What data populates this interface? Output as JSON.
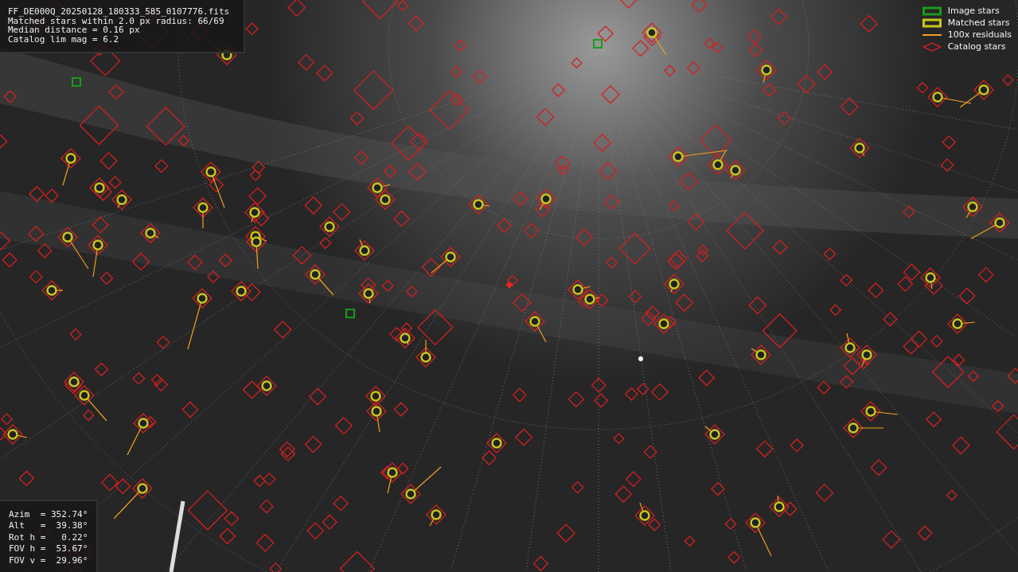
{
  "info_panel": {
    "lines": [
      "FF_DE000Q_20250128_180333_585_0107776.fits",
      "Matched stars within 2.0 px radius: 66/69",
      "Median distance = 0.16 px",
      "Catalog lim mag = 6.2"
    ]
  },
  "legend": [
    {
      "kind": "box",
      "label": "Image stars",
      "color": "#1a9a1a"
    },
    {
      "kind": "box",
      "label": "Matched stars",
      "color": "#c8c81a"
    },
    {
      "kind": "line",
      "label": "100x residuals",
      "color": "#f0a020"
    },
    {
      "kind": "diamond",
      "label": "Catalog stars",
      "color": "#d02020"
    }
  ],
  "pointing_panel": {
    "lines": [
      "Azim  = 352.74°",
      "Alt   =  39.38°",
      "Rot h =   0.22°",
      "FOV h =  53.67°",
      "FOV v =  29.96°"
    ]
  }
}
